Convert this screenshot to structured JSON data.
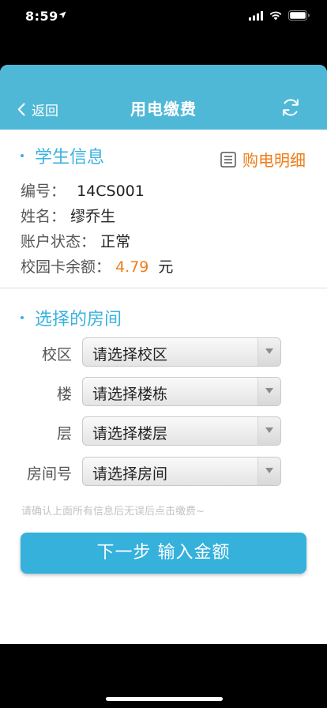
{
  "status": {
    "time": "8:59"
  },
  "nav": {
    "back_label": "返回",
    "title": "用电缴费"
  },
  "student_section": {
    "title": "学生信息",
    "detail_link": "购电明细",
    "rows": [
      {
        "label": "编号：",
        "value": "14CS001"
      },
      {
        "label": "姓名：",
        "value": "缪乔生"
      },
      {
        "label": "账户状态：",
        "value": "正常"
      },
      {
        "label": "校园卡余额：",
        "value": "4.79",
        "unit": "元"
      }
    ]
  },
  "room_section": {
    "title": "选择的房间",
    "fields": [
      {
        "label": "校区",
        "placeholder": "请选择校区"
      },
      {
        "label": "楼",
        "placeholder": "请选择楼栋"
      },
      {
        "label": "层",
        "placeholder": "请选择楼层"
      },
      {
        "label": "房间号",
        "placeholder": "请选择房间"
      }
    ],
    "hint": "请确认上面所有信息后无误后点击缴费~"
  },
  "next_button": "下一步 输入金额",
  "colors": {
    "accent": "#39b2df",
    "nav_bg": "#50b8d7",
    "orange": "#f07d1a",
    "button": "#35b1dc"
  },
  "icons": [
    "location-arrow-icon",
    "signal-icon",
    "wifi-icon",
    "battery-icon",
    "back-chevron-icon",
    "refresh-icon",
    "list-icon",
    "dropdown-arrow-icon"
  ]
}
